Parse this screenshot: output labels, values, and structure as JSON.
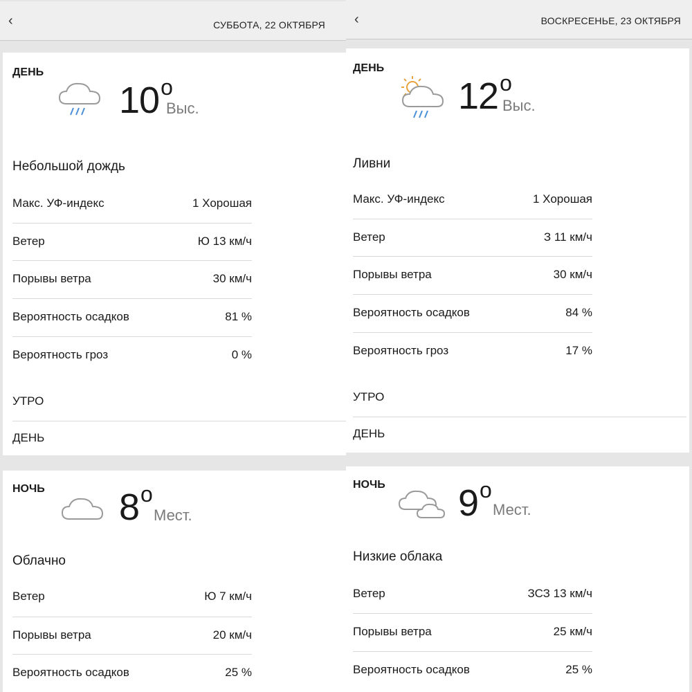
{
  "icons": {
    "back": "chevron-left-icon",
    "rain": "cloud-rain-icon",
    "sun_rain": "sun-cloud-rain-icon",
    "cloud": "cloud-icon",
    "clouds": "clouds-icon"
  },
  "days": [
    {
      "back_glyph": "‹",
      "date": "СУББОТА, 22 ОКТЯБРЯ",
      "day": {
        "label": "ДЕНЬ",
        "temp": "10",
        "deg": "o",
        "temp_label": "Выс.",
        "condition": "Небольшой дождь",
        "details": [
          {
            "label": "Макс. УФ-индекс",
            "value": "1 Хорошая"
          },
          {
            "label": "Ветер",
            "value": "Ю 13 км/ч"
          },
          {
            "label": "Порывы ветра",
            "value": "30 км/ч"
          },
          {
            "label": "Вероятность осадков",
            "value": "81 %"
          },
          {
            "label": "Вероятность гроз",
            "value": "0 %"
          }
        ],
        "sections": [
          "УТРО",
          "ДЕНЬ"
        ]
      },
      "night": {
        "label": "НОЧЬ",
        "temp": "8",
        "deg": "o",
        "temp_label": "Мест.",
        "condition": "Облачно",
        "details": [
          {
            "label": "Ветер",
            "value": "Ю 7 км/ч"
          },
          {
            "label": "Порывы ветра",
            "value": "20 км/ч"
          },
          {
            "label": "Вероятность осадков",
            "value": "25 %"
          }
        ]
      }
    },
    {
      "back_glyph": "‹",
      "date": "ВОСКРЕСЕНЬЕ, 23 ОКТЯБРЯ",
      "day": {
        "label": "ДЕНЬ",
        "temp": "12",
        "deg": "o",
        "temp_label": "Выс.",
        "condition": "Ливни",
        "details": [
          {
            "label": "Макс. УФ-индекс",
            "value": "1 Хорошая"
          },
          {
            "label": "Ветер",
            "value": "З 11 км/ч"
          },
          {
            "label": "Порывы ветра",
            "value": "30 км/ч"
          },
          {
            "label": "Вероятность осадков",
            "value": "84 %"
          },
          {
            "label": "Вероятность гроз",
            "value": "17 %"
          }
        ],
        "sections": [
          "УТРО",
          "ДЕНЬ"
        ]
      },
      "night": {
        "label": "НОЧЬ",
        "temp": "9",
        "deg": "o",
        "temp_label": "Мест.",
        "condition": "Низкие облака",
        "details": [
          {
            "label": "Ветер",
            "value": "ЗСЗ 13 км/ч"
          },
          {
            "label": "Порывы ветра",
            "value": "25 км/ч"
          },
          {
            "label": "Вероятность осадков",
            "value": "25 %"
          }
        ]
      }
    }
  ]
}
